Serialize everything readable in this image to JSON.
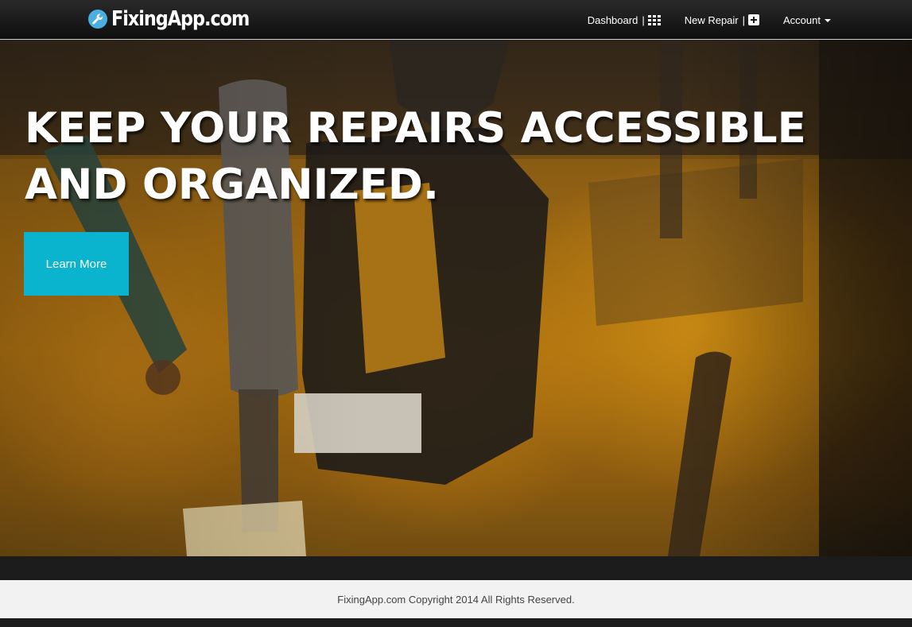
{
  "brand": {
    "name": "FixingApp.com",
    "icon": "wrench-icon",
    "icon_color": "#4aaee0"
  },
  "nav": {
    "dashboard": {
      "label": "Dashboard",
      "separator": "|",
      "icon": "grid-icon"
    },
    "new_repair": {
      "label": "New Repair",
      "separator": "|",
      "icon": "plus-square-icon"
    },
    "account": {
      "label": "Account",
      "icon": "caret-down-icon"
    }
  },
  "hero": {
    "heading": "KEEP YOUR REPAIRS ACCESSIBLE AND ORGANIZED.",
    "button_label": "Learn More",
    "button_color": "#0ab4cf"
  },
  "footer": {
    "text": "FixingApp.com Copyright 2014 All Rights Reserved."
  }
}
